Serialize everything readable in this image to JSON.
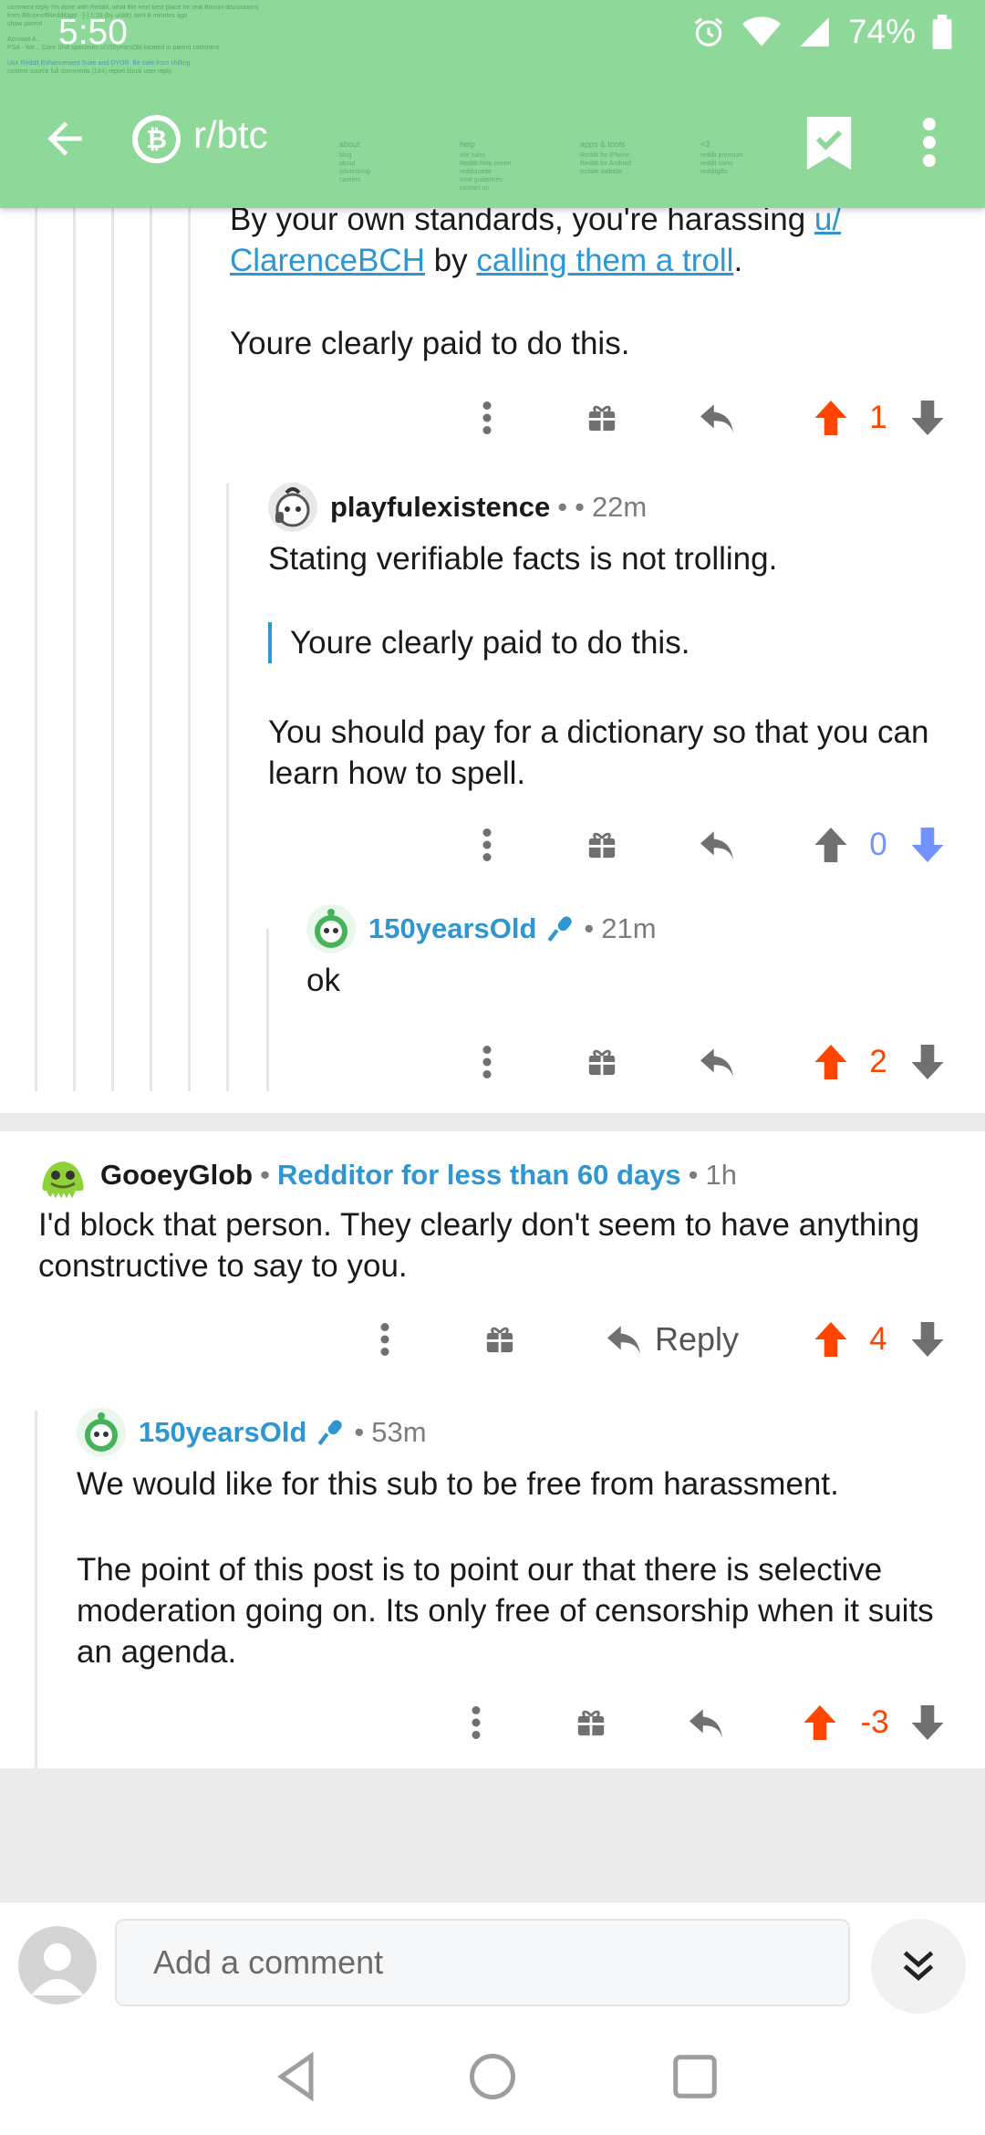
{
  "status_bar": {
    "time": "5:50",
    "battery": "74%"
  },
  "toolbar": {
    "subreddit": "r/btc",
    "subreddit_icon_letter": "₿"
  },
  "ghost_overlay": {
    "lines": [
      "comment reply  I'm done with Reddit, what the next best place for real Bitcoin discussions",
      "from BitcoinoffRedditapp - [-] 1:26 (by u/ddr) sent 8 minutes ago",
      "show parent",
      "Account A...",
      "PSA - We... Core Shill specimen u/150yearsOld located in parent comment",
      "Use Reddit Enhancement Suite and DYOR. Be safe from shilling",
      "context   source   full comments (184)   report   block user   reply"
    ],
    "menu_columns": [
      {
        "head": "about",
        "items": [
          "blog",
          "about",
          "advertising",
          "careers"
        ]
      },
      {
        "head": "help",
        "items": [
          "site rules",
          "Reddit help center",
          "reddiquette",
          "mod guidelines",
          "contact us"
        ]
      },
      {
        "head": "apps & tools",
        "items": [
          "Reddit for iPhone",
          "Reddit for Android",
          "mobile website"
        ]
      },
      {
        "head": "<3",
        "items": [
          "reddit premium",
          "reddit coins",
          "redditgifts"
        ]
      }
    ]
  },
  "comments": [
    {
      "id": "c1",
      "text_part1": "By your own standards, you're harassing ",
      "mention": "u/ ClarenceBCH",
      "text_part2": "  by ",
      "link_text": "calling them a troll",
      "text_part3": ".",
      "paragraph2": "Youre clearly paid to do this.",
      "score": "1"
    },
    {
      "id": "c2",
      "author": "playfulexistence",
      "time": "22m",
      "text1": "Stating verifiable facts is not trolling.",
      "quote": "Youre clearly paid to do this.",
      "text2": "You should pay for a dictionary so that you can learn how to spell.",
      "score": "0"
    },
    {
      "id": "c3",
      "author": "150yearsOld",
      "time": "21m",
      "text": "ok",
      "score": "2"
    },
    {
      "id": "c4",
      "author": "GooeyGlob",
      "flair": "Redditor for less than 60 days",
      "time": "1h",
      "text": "I'd block that person. They clearly don't seem to have anything constructive to say to you.",
      "reply_label": "Reply",
      "score": "4"
    },
    {
      "id": "c5",
      "author": "150yearsOld",
      "time": "53m",
      "text1": "We would like for this sub to be free from harassment.",
      "text2": "The point of this post is to point our that there is selective moderation going on. Its only free of censorship when it suits an agenda.",
      "score": "-3"
    }
  ],
  "comment_bar": {
    "placeholder": "Add a comment"
  },
  "colors": {
    "header": "#8ed99a",
    "upvote": "#ff4500",
    "downvote": "#7193ff",
    "link": "#2e96d0"
  },
  "icons": [
    "back-arrow-icon",
    "bookmark-check-icon",
    "overflow-menu-icon",
    "more-icon",
    "award-icon",
    "reply-icon",
    "upvote-icon",
    "downvote-icon",
    "double-chevron-down-icon",
    "alarm-icon",
    "wifi-icon",
    "signal-icon",
    "battery-icon"
  ]
}
